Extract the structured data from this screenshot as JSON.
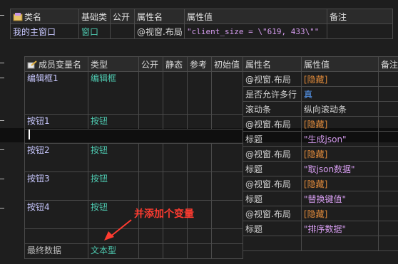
{
  "class_table": {
    "headers": [
      "类名",
      "基础类",
      "公开",
      "属性名",
      "属性值",
      "备注"
    ],
    "row": {
      "class_name": "我的主窗口",
      "base_class": "窗口",
      "public": "",
      "prop_name": "@视窗.布局",
      "prop_value": "\"client_size = \\\"619, 433\\\"\"",
      "note": ""
    }
  },
  "member_table": {
    "headers": [
      "成员变量名",
      "类型",
      "公开",
      "静态",
      "参考",
      "初始值"
    ],
    "rows": [
      {
        "name": "编辑框1",
        "type": "编辑框"
      },
      {
        "name": "按钮1",
        "type": "按钮"
      },
      {
        "name": "按钮2",
        "type": "按钮"
      },
      {
        "name": "按钮3",
        "type": "按钮"
      },
      {
        "name": "按钮4",
        "type": "按钮"
      },
      {
        "name": "最终数据",
        "type": "文本型"
      }
    ]
  },
  "prop_table": {
    "headers": [
      "属性名",
      "属性值",
      "备注"
    ],
    "rows": [
      {
        "name": "@视窗.布局",
        "value": "[隐藏]"
      },
      {
        "name": "是否允许多行",
        "value": "真"
      },
      {
        "name": "滚动条",
        "value": "纵向滚动条"
      },
      {
        "name": "@视窗.布局",
        "value": "[隐藏]"
      },
      {
        "name": "标题",
        "value": "\"生成json\""
      },
      {
        "name": "@视窗.布局",
        "value": "[隐藏]"
      },
      {
        "name": "标题",
        "value": "\"取json数据\""
      },
      {
        "name": "@视窗.布局",
        "value": "[隐藏]"
      },
      {
        "name": "标题",
        "value": "\"替换键值\""
      },
      {
        "name": "@视窗.布局",
        "value": "[隐藏]"
      },
      {
        "name": "标题",
        "value": "\"排序数据\""
      }
    ]
  },
  "annotation": {
    "text": "并添加个变量",
    "color": "#ff3b30"
  }
}
